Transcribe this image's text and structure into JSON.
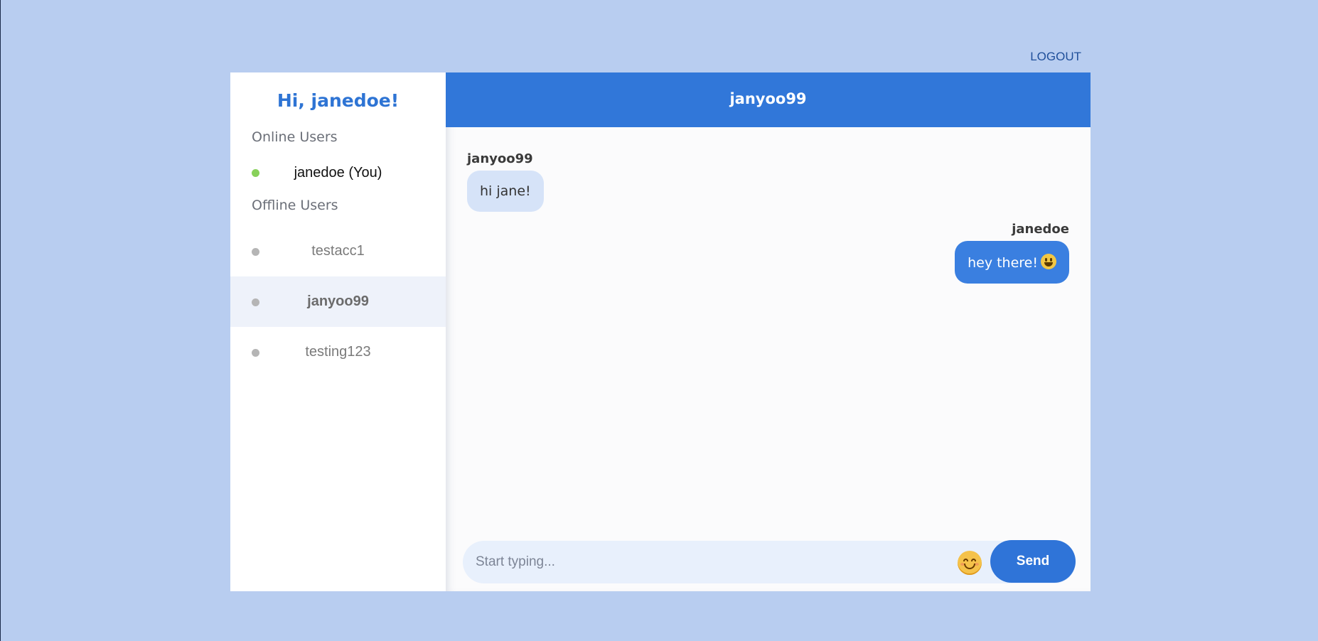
{
  "header": {
    "logout_label": "LOGOUT"
  },
  "sidebar": {
    "greeting": "Hi, janedoe!",
    "online_label": "Online Users",
    "offline_label": "Offline Users",
    "online_users": [
      {
        "name": "janedoe (You)",
        "status": "online"
      }
    ],
    "offline_users": [
      {
        "name": "testacc1",
        "status": "offline",
        "active": false
      },
      {
        "name": "janyoo99",
        "status": "offline",
        "active": true
      },
      {
        "name": "testing123",
        "status": "offline",
        "active": false
      }
    ]
  },
  "chat": {
    "title": "janyoo99",
    "messages": [
      {
        "sender": "janyoo99",
        "text": "hi jane!",
        "direction": "incoming"
      },
      {
        "sender": "janedoe",
        "text": "hey there!",
        "emoji": "grinning-face-icon",
        "direction": "outgoing"
      }
    ],
    "composer": {
      "placeholder": "Start typing...",
      "value": "",
      "emoji_icon": "smiling-face-icon",
      "send_label": "Send"
    }
  },
  "colors": {
    "page_bg": "#b8cdf0",
    "accent": "#3177d9",
    "online_dot": "#88d15a",
    "offline_dot": "#b5b5b5",
    "incoming_bubble": "#d6e3f8",
    "outgoing_bubble": "#3a7fe0"
  }
}
